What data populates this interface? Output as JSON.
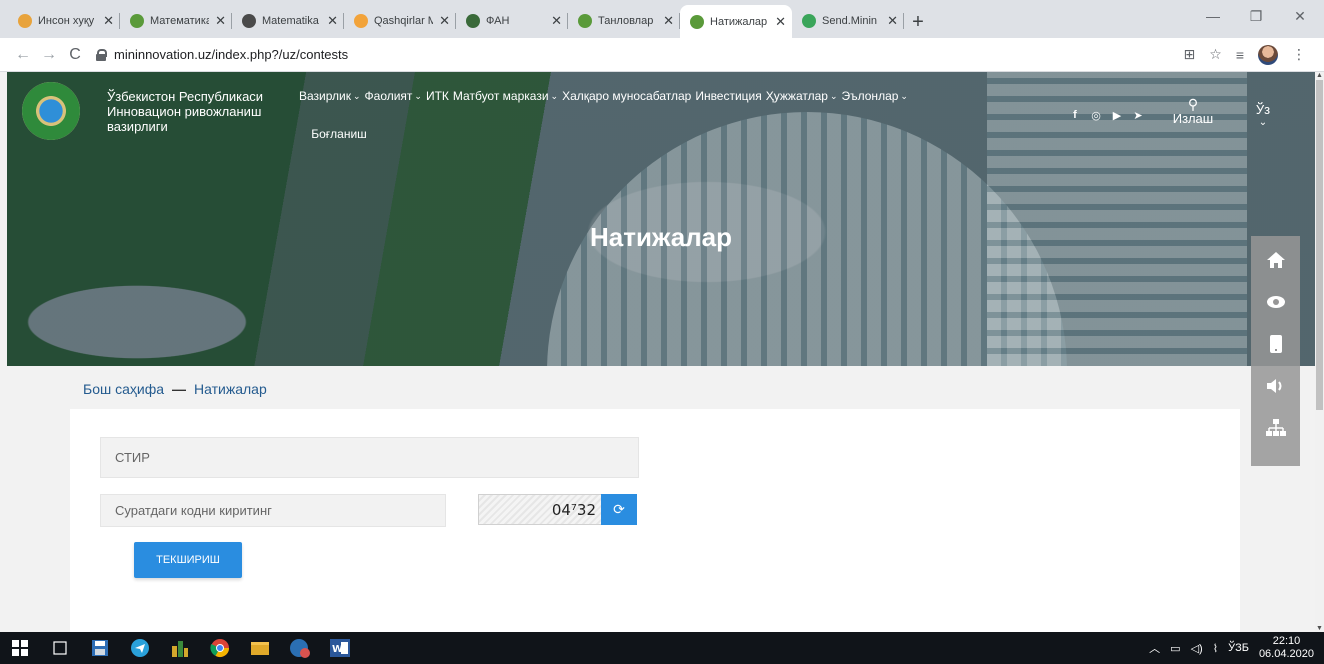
{
  "browser": {
    "tabs": [
      {
        "title": "Инсон хуқу",
        "favicon_color": "#e8a33c"
      },
      {
        "title": "Математика",
        "favicon_color": "#5a9a3a"
      },
      {
        "title": "Matematika",
        "favicon_color": "#4a4a4a"
      },
      {
        "title": "Qashqirlar M",
        "favicon_color": "#f2a33a"
      },
      {
        "title": "ФАН",
        "favicon_color": "#3a6a3a"
      },
      {
        "title": "Танловлар",
        "favicon_color": "#5a9a3a"
      },
      {
        "title": "Натижалар",
        "favicon_color": "#5a9a3a",
        "active": true
      },
      {
        "title": "Send.Minin",
        "favicon_color": "#3aa55a"
      }
    ],
    "url": "mininnovation.uz/index.php?/uz/contests"
  },
  "site": {
    "brand_line1": "Ўзбекистон Республикаси",
    "brand_line2": "Инновацион ривожланиш",
    "brand_line3": "вазирлиги",
    "menu": [
      {
        "label": "Вазирлик",
        "dropdown": true
      },
      {
        "label": "Фаолият",
        "dropdown": true
      },
      {
        "label": "ИТК",
        "dropdown": false
      },
      {
        "label": "Матбуот маркази",
        "dropdown": true
      },
      {
        "label": "Халқаро муносабатлар",
        "dropdown": false
      },
      {
        "label": "Инвестиция",
        "dropdown": false
      },
      {
        "label": "Ҳужжатлар",
        "dropdown": true
      },
      {
        "label": "Эълонлар",
        "dropdown": true
      }
    ],
    "menu_contact": "Боғланиш",
    "search_label": "Излаш",
    "lang_label": "Ўз",
    "hero_title": "Натижалар"
  },
  "breadcrumb": {
    "home": "Бош саҳифа",
    "separator": "—",
    "current": "Натижалар"
  },
  "form": {
    "stir_placeholder": "СТИР",
    "captcha_placeholder": "Суратдаги кодни киритинг",
    "captcha_code": "04⁷32",
    "submit_label": "ТЕКШИРИШ"
  },
  "taskbar": {
    "lang": "ЎЗБ",
    "time": "22:10",
    "date": "06.04.2020"
  },
  "colors": {
    "accent": "#2a8de0",
    "breadcrumb": "#245b8f"
  }
}
